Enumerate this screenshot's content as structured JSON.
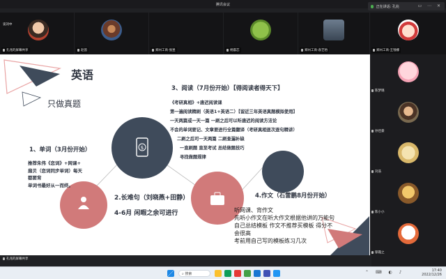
{
  "window": {
    "title": "腾讯会议",
    "controls": [
      "–",
      "□",
      "✕"
    ]
  },
  "speaking": {
    "text": "正在讲话: 孔兆",
    "ctrl_icons": "▭ ⋯ ✕"
  },
  "top_tiles": [
    {
      "name": "孔兆的屏幕共享",
      "top_label": "谈刘中"
    },
    {
      "name": "赵茵"
    },
    {
      "name": "郑州工商-张昱"
    },
    {
      "name": "杨晨芯"
    },
    {
      "name": "郑州工商-袁艺怡"
    },
    {
      "name": "郑州工商-王钱娜"
    }
  ],
  "side_tiles": [
    {
      "name": "陈梦璐"
    },
    {
      "name": "孙佳豪"
    },
    {
      "name": "刘浩"
    },
    {
      "name": "陈小小"
    },
    {
      "name": "郁霞之"
    }
  ],
  "slide": {
    "title": "英语",
    "subtitle": "只做真题",
    "section1_title": "1、单词（3月份开始）",
    "section1_lines": [
      "推荐朱伟《恋词》+网课+",
      "扇贝（恋词同步单词）每天",
      "都要背",
      "单词书最好从一而终。"
    ],
    "section2_title": "2.长难句（刘晓燕+田静）",
    "section2_sub": "4-6月 闲暇之余可进行",
    "section3_title": "3、阅读（7月份开始）【得阅读者得天下】",
    "section3_lines": [
      "《考研真相》+唐迟阅读课",
      "第一遍阅读精刷（英语1+英语二）【留近三年英语真题模拟使用】",
      "一天两篇或一天一篇 一刷之后可以听唐迟的阅读方法论",
      "不会的单词要记、文章要进行全篇翻译（考研真相逐次逐句精讲）",
      "二刷之后可一天两篇  二刷查漏补缺",
      "一直刷题 直至考试 总结做题技巧",
      "寻找做题规律"
    ],
    "section4_title": "4.作文（石雷鹏8月份开始）",
    "handwritten": [
      "听网课、背作文",
      "先听小作文在听大作文根据他讲的万能句",
      "自己总结模板   作文不推荐买模板 得分不",
      "会很高",
      "考前用自己写的模板练习几次"
    ]
  },
  "share_label": "孔兆的屏幕共享",
  "taskbar": {
    "search_text": "搜索",
    "time": "17:40",
    "date": "2022/12/26"
  },
  "colors": {
    "slate": "#3f4b5b",
    "coral": "#d17a7a",
    "pink_outline": "#e9a3a3",
    "app_bg": "#202124"
  }
}
